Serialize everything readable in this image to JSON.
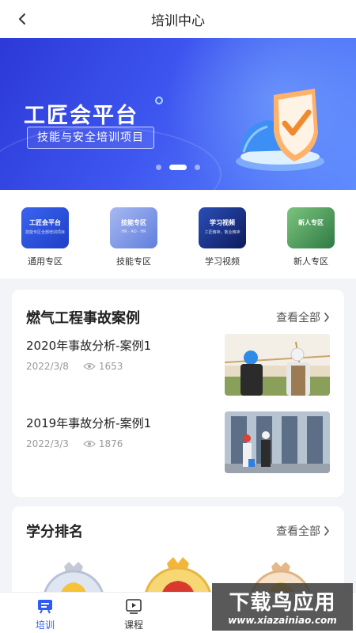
{
  "header": {
    "title": "培训中心"
  },
  "banner": {
    "title": "工匠会平台",
    "subtitle": "技能与安全培训项目",
    "slide_count": 3,
    "active_slide": 2
  },
  "zones": [
    {
      "label": "通用专区",
      "tile_title": "工匠会平台",
      "tile_sub": "技能专区全部培训项目",
      "color": "#2f57e0"
    },
    {
      "label": "技能专区",
      "tile_title": "技能专区",
      "tile_sub": "HR · AO · HR",
      "color": "#7f9ae6"
    },
    {
      "label": "学习视频",
      "tile_title": "学习视频",
      "tile_sub": "工匠精神，敬业精神",
      "color": "#1b2f86"
    },
    {
      "label": "新人专区",
      "tile_title": "新人专区",
      "tile_sub": "",
      "color": "#4c9b5c"
    }
  ],
  "cases": {
    "title": "燃气工程事故案例",
    "see_all": "查看全部",
    "items": [
      {
        "title": "2020年事故分析-案例1",
        "date": "2022/3/8",
        "views": "1653"
      },
      {
        "title": "2019年事故分析-案例1",
        "date": "2022/3/3",
        "views": "1876"
      }
    ]
  },
  "ranking": {
    "title": "学分排名",
    "see_all": "查看全部"
  },
  "tabs": [
    {
      "label": "培训",
      "icon": "training-icon",
      "active": true
    },
    {
      "label": "课程",
      "icon": "course-icon",
      "active": false
    }
  ],
  "watermark": {
    "line1": "下载鸟应用",
    "line2": "www.xiazainiao.com"
  },
  "colors": {
    "accent": "#2d5bf6",
    "banner_start": "#2c39d6",
    "banner_end": "#5f8cff"
  }
}
